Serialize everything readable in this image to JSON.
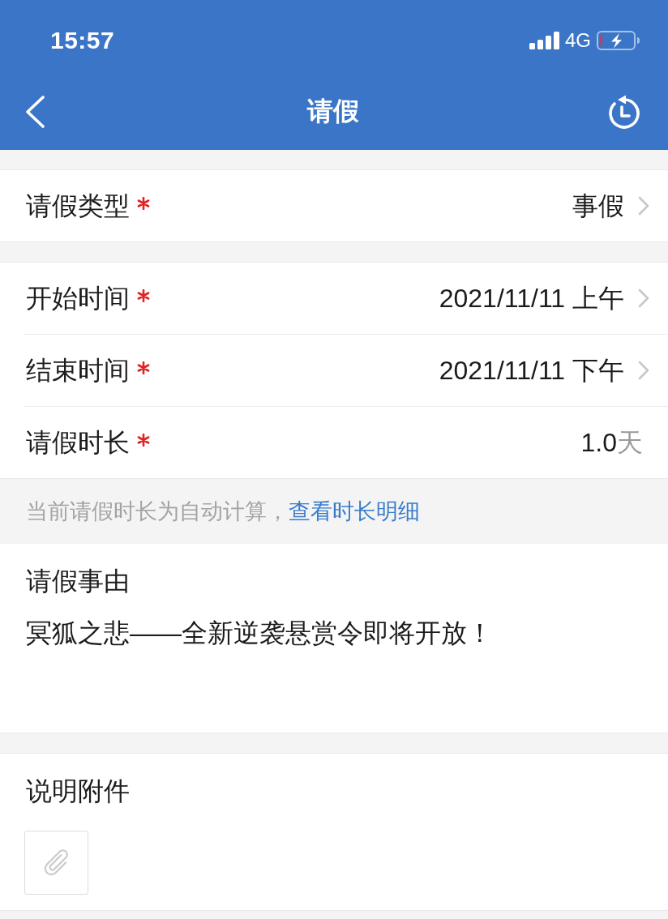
{
  "status_bar": {
    "time": "15:57",
    "network": "4G"
  },
  "nav_bar": {
    "title": "请假"
  },
  "sections": [
    {
      "rows": [
        {
          "kind": "select",
          "label": "请假类型",
          "required": true,
          "value": "事假"
        }
      ]
    },
    {
      "rows": [
        {
          "kind": "select",
          "label": "开始时间",
          "required": true,
          "value": "2021/11/11 上午"
        },
        {
          "kind": "select",
          "label": "结束时间",
          "required": true,
          "value": "2021/11/11 下午"
        },
        {
          "kind": "readonly",
          "label": "请假时长",
          "required": true,
          "value": "1.0",
          "unit": "天"
        }
      ]
    }
  ],
  "hint": {
    "text": "当前请假时长为自动计算，",
    "link": "查看时长明细"
  },
  "reason": {
    "label": "请假事由",
    "value": "冥狐之悲——全新逆袭悬赏令即将开放！"
  },
  "attachments": {
    "label": "说明附件"
  }
}
